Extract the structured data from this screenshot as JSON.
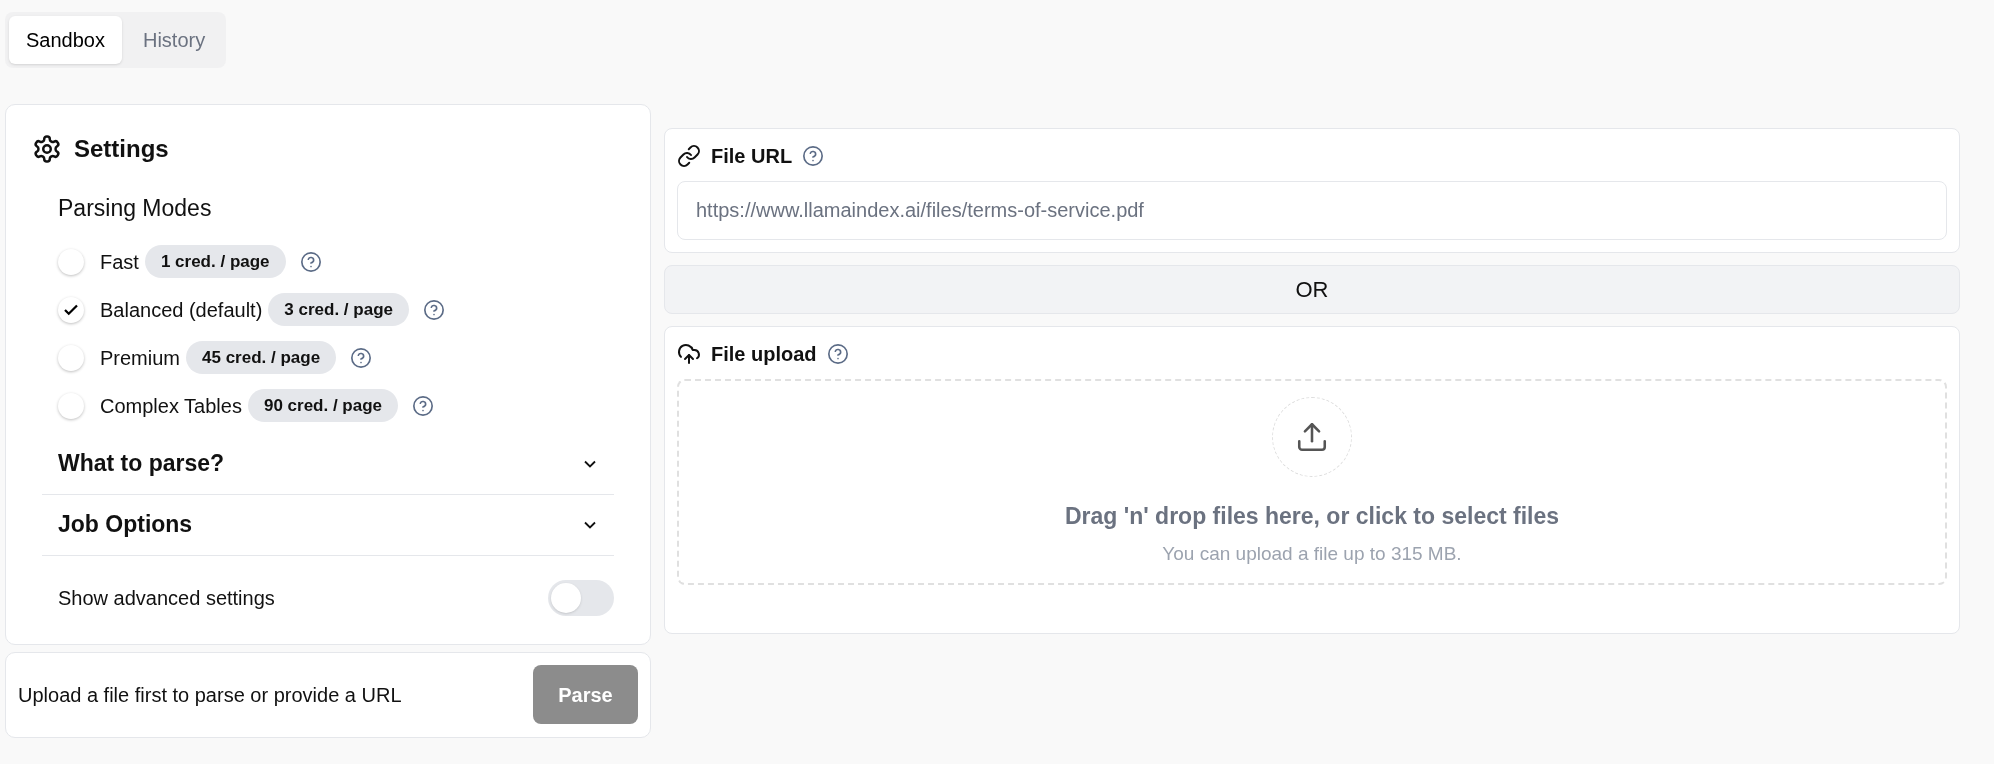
{
  "tabs": [
    {
      "label": "Sandbox",
      "selected": true
    },
    {
      "label": "History",
      "selected": false
    }
  ],
  "settings": {
    "title": "Settings",
    "parsing_modes": {
      "title": "Parsing Modes",
      "options": [
        {
          "label": "Fast",
          "badge": "1 cred. / page",
          "selected": false
        },
        {
          "label": "Balanced (default)",
          "badge": "3 cred. / page",
          "selected": true
        },
        {
          "label": "Premium",
          "badge": "45 cred. / page",
          "selected": false
        },
        {
          "label": "Complex Tables",
          "badge": "90 cred. / page",
          "selected": false
        }
      ]
    },
    "sections": [
      {
        "title": "What to parse?",
        "expanded": false
      },
      {
        "title": "Job Options",
        "expanded": false
      }
    ],
    "advanced": {
      "label": "Show advanced settings",
      "on": false
    }
  },
  "parse_bar": {
    "message": "Upload a file first to parse or provide a URL",
    "button": "Parse",
    "disabled": true
  },
  "file_url": {
    "title": "File URL",
    "placeholder": "https://www.llamaindex.ai/files/terms-of-service.pdf"
  },
  "divider": "OR",
  "file_upload": {
    "title": "File upload",
    "prompt": "Drag 'n' drop files here, or click to select files",
    "hint": "You can upload a file up to 315 MB."
  }
}
